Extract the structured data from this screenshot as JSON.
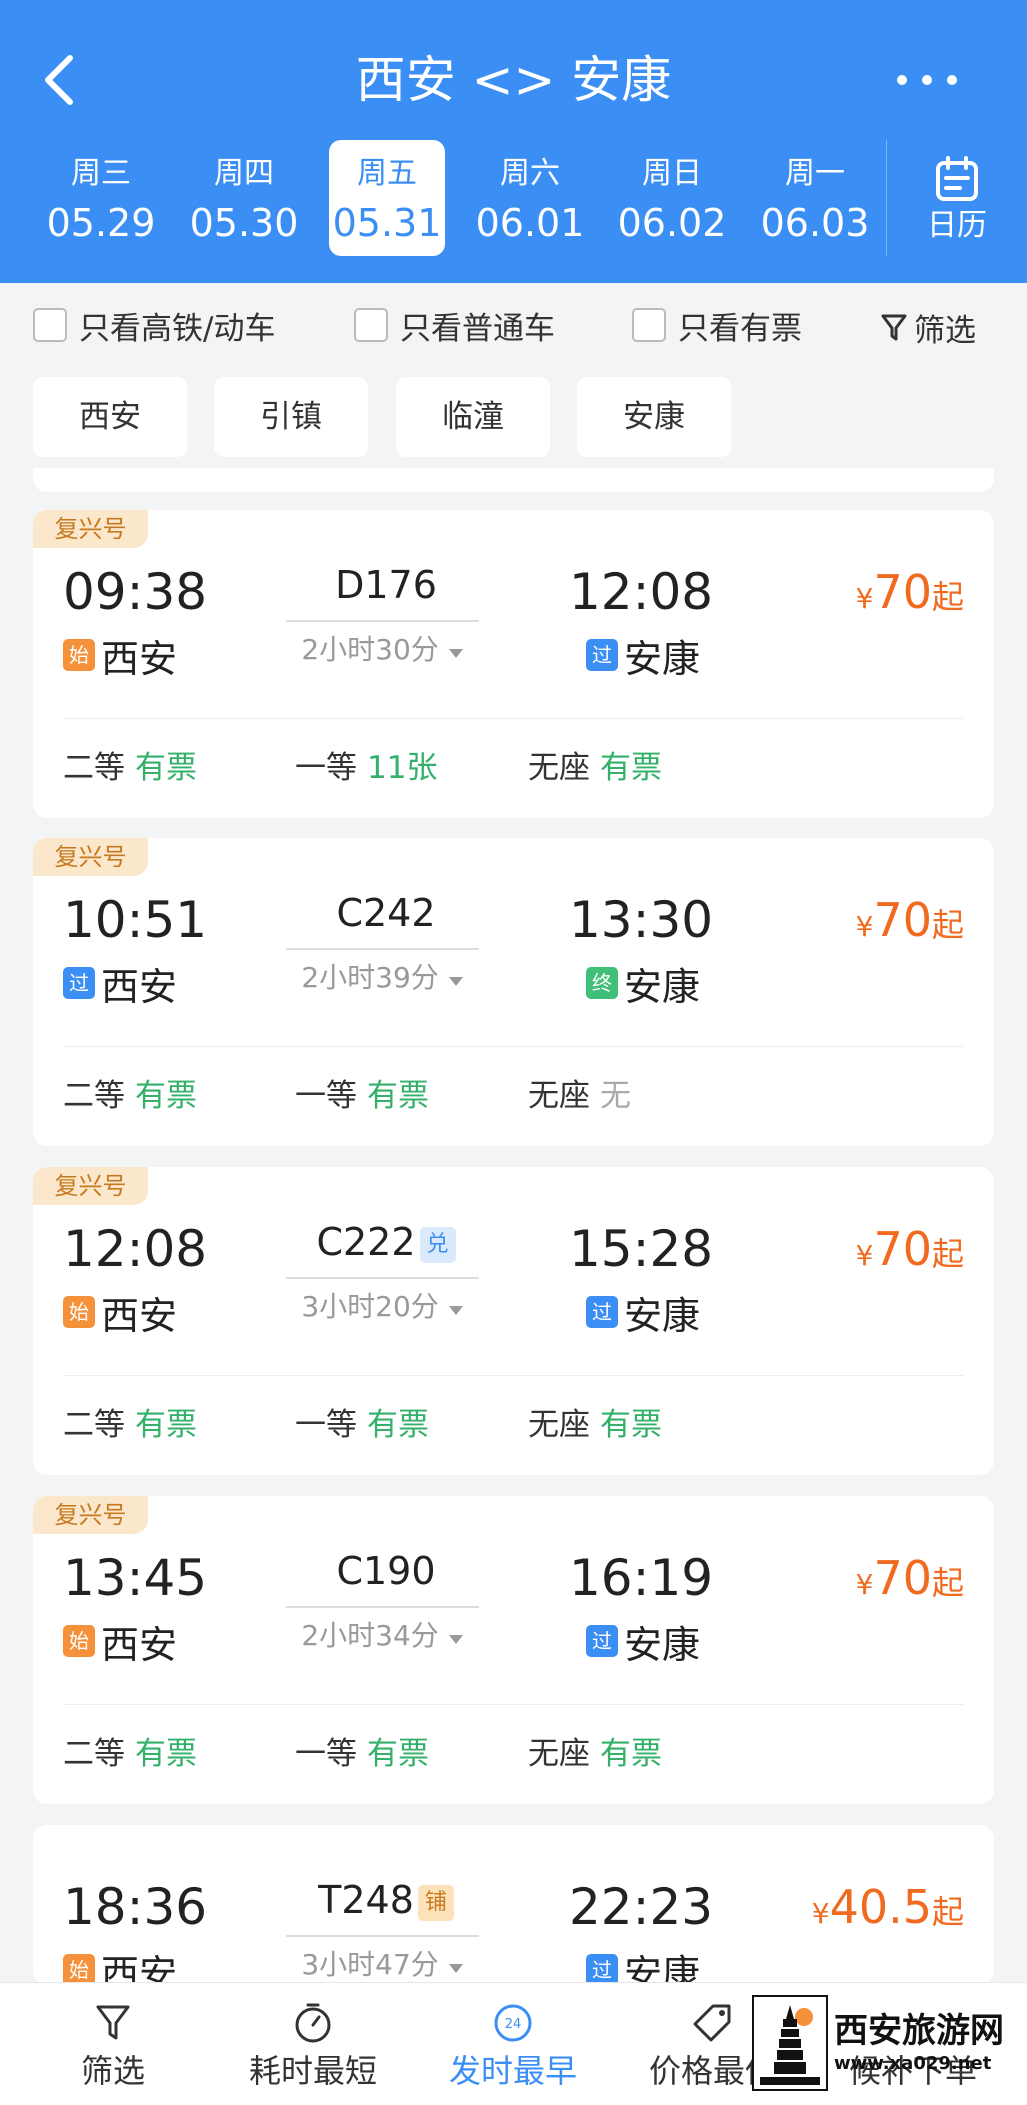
{
  "header": {
    "title": "西安 <> 安康",
    "dates": [
      {
        "weekday": "周三",
        "date": "05.29"
      },
      {
        "weekday": "周四",
        "date": "05.30"
      },
      {
        "weekday": "周五",
        "date": "05.31"
      },
      {
        "weekday": "周六",
        "date": "06.01"
      },
      {
        "weekday": "周日",
        "date": "06.02"
      },
      {
        "weekday": "周一",
        "date": "06.03"
      }
    ],
    "active_date_index": 2,
    "calendar_label": "日历"
  },
  "filters": {
    "high_speed": "只看高铁/动车",
    "normal": "只看普通车",
    "available": "只看有票",
    "filter_label": "筛选"
  },
  "stations": [
    "西安",
    "引镇",
    "临潼",
    "安康"
  ],
  "trains": [
    {
      "badge": "复兴号",
      "dep_time": "09:38",
      "dep_station": "西安",
      "dep_tag": "始",
      "train_no": "D176",
      "extra": "",
      "duration": "2小时30分",
      "arr_time": "12:08",
      "arr_station": "安康",
      "arr_tag": "过",
      "price": "70",
      "price_suffix": "起",
      "seats": [
        {
          "name": "二等",
          "avail": "有票"
        },
        {
          "name": "一等",
          "avail": "11张"
        },
        {
          "name": "无座",
          "avail": "有票"
        }
      ]
    },
    {
      "badge": "复兴号",
      "dep_time": "10:51",
      "dep_station": "西安",
      "dep_tag": "过",
      "train_no": "C242",
      "extra": "",
      "duration": "2小时39分",
      "arr_time": "13:30",
      "arr_station": "安康",
      "arr_tag": "终",
      "price": "70",
      "price_suffix": "起",
      "seats": [
        {
          "name": "二等",
          "avail": "有票"
        },
        {
          "name": "一等",
          "avail": "有票"
        },
        {
          "name": "无座",
          "avail": "无"
        }
      ]
    },
    {
      "badge": "复兴号",
      "dep_time": "12:08",
      "dep_station": "西安",
      "dep_tag": "始",
      "train_no": "C222",
      "extra": "兑",
      "duration": "3小时20分",
      "arr_time": "15:28",
      "arr_station": "安康",
      "arr_tag": "过",
      "price": "70",
      "price_suffix": "起",
      "seats": [
        {
          "name": "二等",
          "avail": "有票"
        },
        {
          "name": "一等",
          "avail": "有票"
        },
        {
          "name": "无座",
          "avail": "有票"
        }
      ]
    },
    {
      "badge": "复兴号",
      "dep_time": "13:45",
      "dep_station": "西安",
      "dep_tag": "始",
      "train_no": "C190",
      "extra": "",
      "duration": "2小时34分",
      "arr_time": "16:19",
      "arr_station": "安康",
      "arr_tag": "过",
      "price": "70",
      "price_suffix": "起",
      "seats": [
        {
          "name": "二等",
          "avail": "有票"
        },
        {
          "name": "一等",
          "avail": "有票"
        },
        {
          "name": "无座",
          "avail": "有票"
        }
      ]
    },
    {
      "badge": "",
      "dep_time": "18:36",
      "dep_station": "西安",
      "dep_tag": "始",
      "train_no": "T248",
      "extra": "铺",
      "duration": "3小时47分",
      "arr_time": "22:23",
      "arr_station": "安康",
      "arr_tag": "过",
      "price": "40.5",
      "price_suffix": "起",
      "seats": []
    }
  ],
  "currency": "¥",
  "bottom_tabs": [
    {
      "label": "筛选",
      "icon": "funnel-icon"
    },
    {
      "label": "耗时最短",
      "icon": "stopwatch-icon"
    },
    {
      "label": "发时最早",
      "icon": "clock-24-icon"
    },
    {
      "label": "价格最低",
      "icon": "price-tag-icon"
    },
    {
      "label": "候补下单",
      "icon": "queue-icon"
    }
  ],
  "active_tab_index": 2,
  "watermark": {
    "name": "西安旅游网",
    "url": "www.xa029.net"
  },
  "colors": {
    "primary": "#3b8ff4",
    "price": "#f06a1f",
    "available": "#34b06a",
    "badge_bg": "#fbe8cc"
  }
}
